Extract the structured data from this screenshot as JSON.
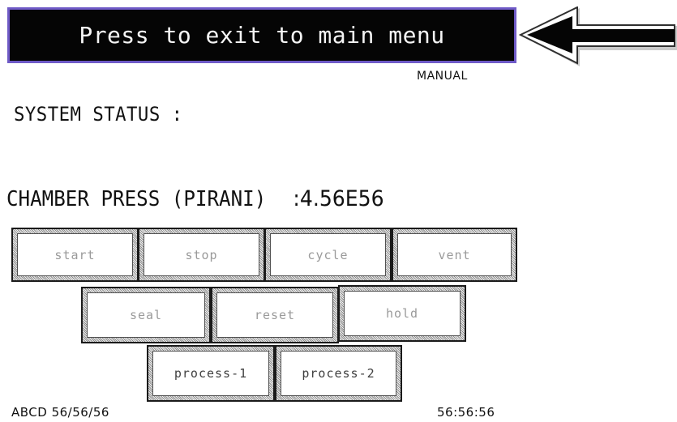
{
  "header": {
    "exit_label": "Press to exit to main menu",
    "pointer_icon": "arrow-left-icon",
    "mode": "MANUAL"
  },
  "status": {
    "heading": "SYSTEM STATUS :"
  },
  "pressure": {
    "label": "CHAMBER PRESS (PIRANI)",
    "value": ":4.56E56"
  },
  "controls": {
    "start": "start",
    "stop": "stop",
    "cycle": "cycle",
    "vent": "vent",
    "seal": "seal",
    "reset": "reset",
    "hold": "hold",
    "process1": "process-1",
    "process2": "process-2"
  },
  "footer": {
    "date": "ABCD 56/56/56",
    "time": "56:56:56"
  },
  "colors": {
    "exit_bar": "#050505",
    "exit_border": "#6f5ac7",
    "button_border": "#1a1a1a"
  }
}
